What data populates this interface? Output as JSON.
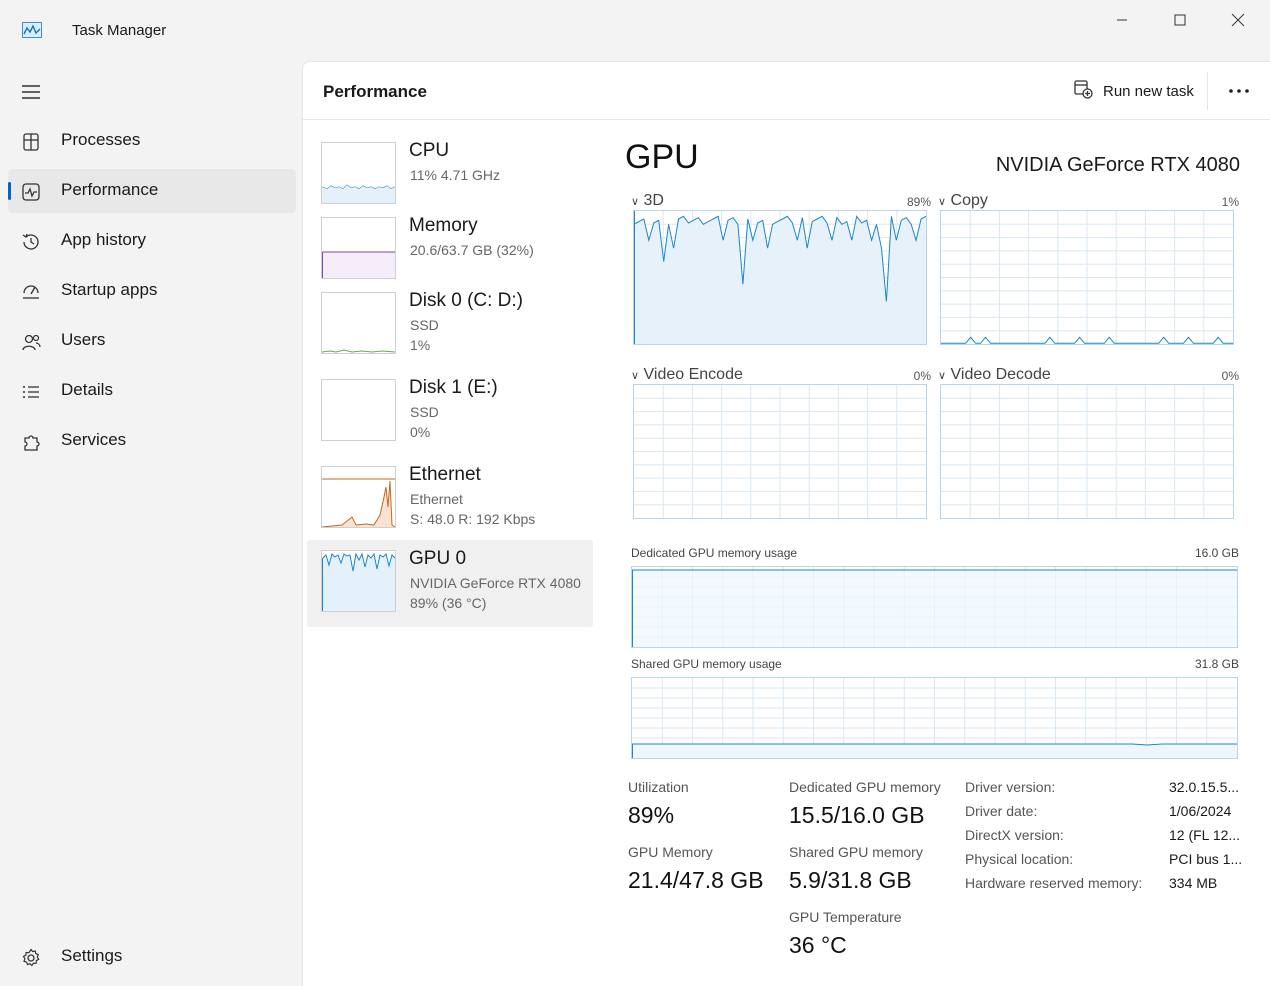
{
  "app": {
    "title": "Task Manager"
  },
  "nav": {
    "items": [
      {
        "label": "Processes"
      },
      {
        "label": "Performance"
      },
      {
        "label": "App history"
      },
      {
        "label": "Startup apps"
      },
      {
        "label": "Users"
      },
      {
        "label": "Details"
      },
      {
        "label": "Services"
      }
    ],
    "settings": "Settings",
    "accent": "#0067c0"
  },
  "header": {
    "title": "Performance",
    "run_new_task": "Run new task"
  },
  "devices": [
    {
      "name": "CPU",
      "line1": "11%  4.71 GHz",
      "line2": ""
    },
    {
      "name": "Memory",
      "line1": "20.6/63.7 GB (32%)",
      "line2": ""
    },
    {
      "name": "Disk 0 (C: D:)",
      "line1": "SSD",
      "line2": "1%"
    },
    {
      "name": "Disk 1 (E:)",
      "line1": "SSD",
      "line2": "0%"
    },
    {
      "name": "Ethernet",
      "line1": "Ethernet",
      "line2": "S: 48.0  R: 192 Kbps"
    },
    {
      "name": "GPU 0",
      "line1": "NVIDIA GeForce RTX 4080",
      "line2": "89% (36 °C)"
    }
  ],
  "gpu": {
    "title": "GPU",
    "model": "NVIDIA GeForce RTX 4080",
    "engines": [
      {
        "name": "3D",
        "percent": "89%"
      },
      {
        "name": "Copy",
        "percent": "1%"
      },
      {
        "name": "Video Encode",
        "percent": "0%"
      },
      {
        "name": "Video Decode",
        "percent": "0%"
      }
    ],
    "dedicated_usage": {
      "label": "Dedicated GPU memory usage",
      "max": "16.0 GB"
    },
    "shared_usage": {
      "label": "Shared GPU memory usage",
      "max": "31.8 GB"
    },
    "stats": {
      "utilization_label": "Utilization",
      "utilization": "89%",
      "dedicated_label": "Dedicated GPU memory",
      "dedicated": "15.5/16.0 GB",
      "gpu_memory_label": "GPU Memory",
      "gpu_memory": "21.4/47.8 GB",
      "shared_label": "Shared GPU memory",
      "shared": "5.9/31.8 GB",
      "temp_label": "GPU Temperature",
      "temp": "36 °C"
    },
    "info": [
      {
        "key": "Driver version:",
        "value": "32.0.15.5..."
      },
      {
        "key": "Driver date:",
        "value": "1/06/2024"
      },
      {
        "key": "DirectX version:",
        "value": "12 (FL 12..."
      },
      {
        "key": "Physical location:",
        "value": "PCI bus 1..."
      },
      {
        "key": "Hardware reserved memory:",
        "value": "334 MB"
      }
    ]
  },
  "colors": {
    "gpu_line": "#1a87c8",
    "memory": "#8e3fb0",
    "ethernet": "#c76a1c",
    "grid": "#d9e8f3"
  }
}
